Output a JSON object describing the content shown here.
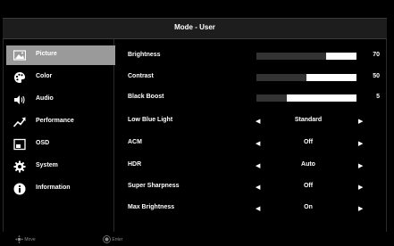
{
  "title": "Mode - User",
  "sidebar": {
    "items": [
      {
        "label": "Picture",
        "icon": "picture-icon",
        "active": true
      },
      {
        "label": "Color",
        "icon": "color-palette-icon",
        "active": false
      },
      {
        "label": "Audio",
        "icon": "speaker-icon",
        "active": false
      },
      {
        "label": "Performance",
        "icon": "performance-icon",
        "active": false
      },
      {
        "label": "OSD",
        "icon": "osd-icon",
        "active": false
      },
      {
        "label": "System",
        "icon": "gear-icon",
        "active": false
      },
      {
        "label": "Information",
        "icon": "info-icon",
        "active": false
      }
    ]
  },
  "settings": {
    "brightness": {
      "label": "Brightness",
      "value": "70",
      "level": 0.7
    },
    "contrast": {
      "label": "Contrast",
      "value": "50",
      "level": 0.5
    },
    "black_boost": {
      "label": "Black Boost",
      "value": "5",
      "level": 0.3
    },
    "low_blue_light": {
      "label": "Low Blue Light",
      "value": "Standard"
    },
    "acm": {
      "label": "ACM",
      "value": "Off"
    },
    "hdr": {
      "label": "HDR",
      "value": "Auto"
    },
    "super_sharpness": {
      "label": "Super Sharpness",
      "value": "Off"
    },
    "max_brightness": {
      "label": "Max Brightness",
      "value": "On"
    }
  },
  "footer": {
    "move": "Move",
    "enter": "Enter"
  },
  "colors": {
    "background": "#000000",
    "active_item": "#9a9a9a",
    "bar_track": "#ffffff",
    "bar_fill": "#333333"
  }
}
